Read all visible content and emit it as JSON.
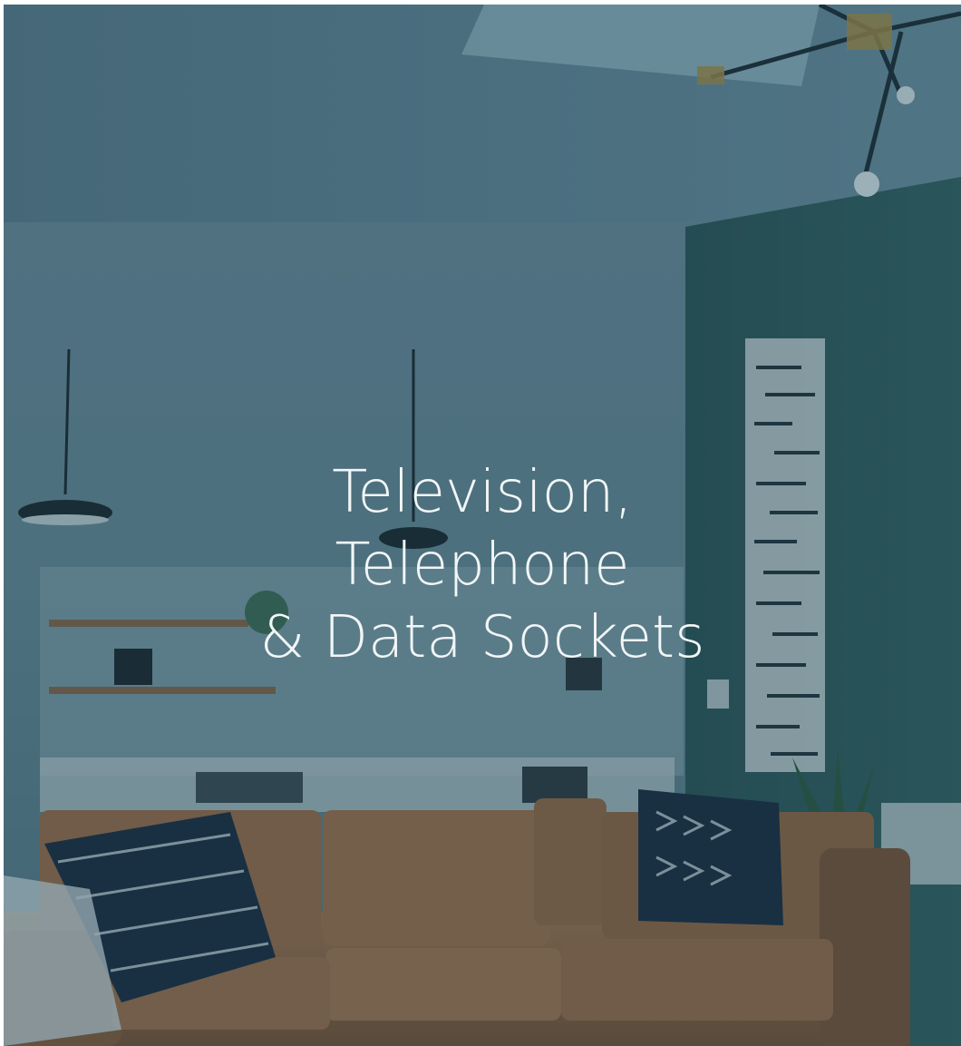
{
  "headline": {
    "line1": "Television,",
    "line2": "Telephone",
    "line3": "& Data Sockets"
  },
  "scene": {
    "subject": "living-room-with-leather-sofa-and-kitchen",
    "tint_color": "#1e4556",
    "sofa_color": "#9a6a45",
    "pillow_color": "#1b2a3e",
    "accent_wall_color": "#2f5a5a"
  }
}
